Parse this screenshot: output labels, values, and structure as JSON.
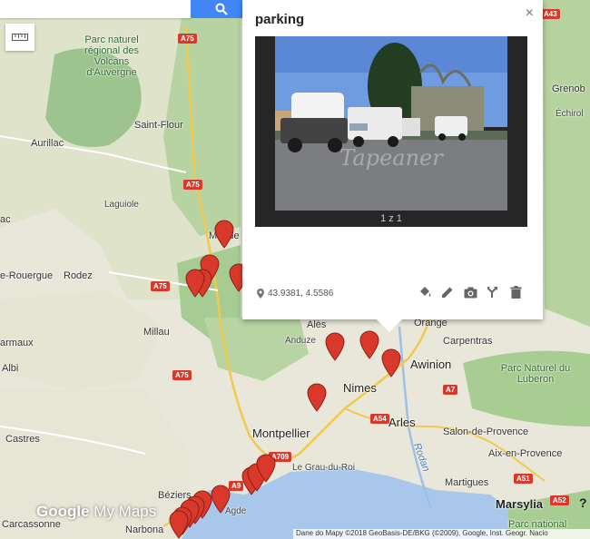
{
  "search": {
    "value": "",
    "button_icon": "search-icon"
  },
  "toolbar": {
    "ruler_icon": "ruler-icon"
  },
  "popup": {
    "title": "parking",
    "close_label": "×",
    "photo_counter": "1 z 1",
    "watermark": "Tapeaner",
    "coordinates": "43.9381, 4.5586",
    "tools": [
      "paint-bucket-icon",
      "pencil-icon",
      "camera-icon",
      "directions-icon",
      "trash-icon"
    ]
  },
  "map": {
    "cities": [
      {
        "id": "montpellier",
        "name": "Montpellier"
      },
      {
        "id": "nimes",
        "name": "Nimes"
      },
      {
        "id": "avinion",
        "name": "Awinion"
      },
      {
        "id": "arles",
        "name": "Arles"
      },
      {
        "id": "marsylia",
        "name": "Marsylia"
      }
    ],
    "towns": [
      {
        "id": "saint-flour",
        "name": "Saint-Flour"
      },
      {
        "id": "aurillac",
        "name": "Aurillac"
      },
      {
        "id": "laguiole",
        "name": "Laguiole"
      },
      {
        "id": "rodez",
        "name": "Rodez"
      },
      {
        "id": "rouergue",
        "name": "e-Rouergue"
      },
      {
        "id": "millau",
        "name": "Millau"
      },
      {
        "id": "carmaux",
        "name": "armaux"
      },
      {
        "id": "albi",
        "name": "Albi"
      },
      {
        "id": "castres",
        "name": "Castres"
      },
      {
        "id": "carcassonne",
        "name": "Carcassonne"
      },
      {
        "id": "narbona",
        "name": "Narbona"
      },
      {
        "id": "beziers",
        "name": "Béziers"
      },
      {
        "id": "agde",
        "name": "Agde"
      },
      {
        "id": "mende",
        "name": "Mende"
      },
      {
        "id": "ales",
        "name": "Alès"
      },
      {
        "id": "anduze",
        "name": "Anduze"
      },
      {
        "id": "orange",
        "name": "Orange"
      },
      {
        "id": "carpentras",
        "name": "Carpentras"
      },
      {
        "id": "le-grau",
        "name": "Le Grau-du-Roi"
      },
      {
        "id": "salon",
        "name": "Salon-de-Provence"
      },
      {
        "id": "aix",
        "name": "Aix-en-Provence"
      },
      {
        "id": "martigues",
        "name": "Martigues"
      },
      {
        "id": "grenoble",
        "name": "Grenob"
      },
      {
        "id": "echirolles",
        "name": "Échirol"
      },
      {
        "id": "ac",
        "name": "ac"
      }
    ],
    "parks": [
      {
        "id": "volcans",
        "name": "Parc naturel régional des Volcans d'Auvergne"
      },
      {
        "id": "luberon",
        "name": "Parc Naturel du Luberon"
      },
      {
        "id": "national",
        "name": "Parc national"
      }
    ],
    "water": [
      {
        "id": "rodan",
        "name": "Rodan"
      }
    ],
    "roads": [
      "A75",
      "A75",
      "A75",
      "A75",
      "A7",
      "A54",
      "A51",
      "A52",
      "A43",
      "A709",
      "A9"
    ],
    "marker_count": 22
  },
  "branding": {
    "logo_google": "Google",
    "logo_mymaps": "My Maps",
    "attribution": "Dane do Mapy ©2018 GeoBasis-DE/BKG (©2009), Google, Inst. Geogr. Nacio",
    "help": "?"
  },
  "colors": {
    "marker": "#d8392b",
    "search_button": "#4285f4",
    "park_green": "#8fc18a",
    "water": "#a8c7ea",
    "land": "#e8e6d9"
  }
}
